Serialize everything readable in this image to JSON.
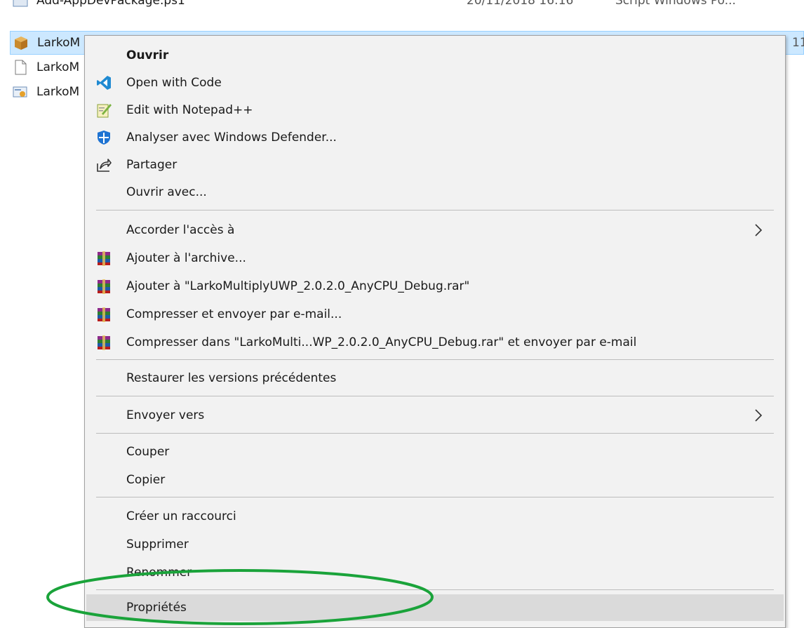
{
  "files": [
    {
      "name": "Add-AppDevPackage.ps1",
      "date": "20/11/2018 16:16",
      "type": "Script Windows Po...",
      "size": "",
      "icon": "powershell-script-icon"
    },
    {
      "name": "LarkoM",
      "date": "",
      "type": "",
      "size": "11",
      "icon": "package-box-icon"
    },
    {
      "name": "LarkoM",
      "date": "",
      "type": "",
      "size": "",
      "icon": "blank-file-icon"
    },
    {
      "name": "LarkoM",
      "date": "",
      "type": "",
      "size": "",
      "icon": "certificate-icon"
    }
  ],
  "menu": {
    "open": "Ouvrir",
    "open_with_code": "Open with Code",
    "edit_notepadpp": "Edit with Notepad++",
    "defender": "Analyser avec Windows Defender...",
    "share": "Partager",
    "open_with": "Ouvrir avec...",
    "grant_access": "Accorder l'accès à",
    "add_archive": "Ajouter à l'archive...",
    "add_rar": "Ajouter à \"LarkoMultiplyUWP_2.0.2.0_AnyCPU_Debug.rar\"",
    "compress_email": "Compresser et envoyer par e-mail...",
    "compress_rar_email": "Compresser dans \"LarkoMulti...WP_2.0.2.0_AnyCPU_Debug.rar\" et envoyer par e-mail",
    "restore_versions": "Restaurer les versions précédentes",
    "send_to": "Envoyer vers",
    "cut": "Couper",
    "copy": "Copier",
    "create_shortcut": "Créer un raccourci",
    "delete": "Supprimer",
    "rename": "Renommer",
    "properties": "Propriétés"
  },
  "colors": {
    "selection": "#cce8ff",
    "menu_bg": "#f2f2f2",
    "menu_hover": "#dadada",
    "annotation": "#1aa33a"
  }
}
